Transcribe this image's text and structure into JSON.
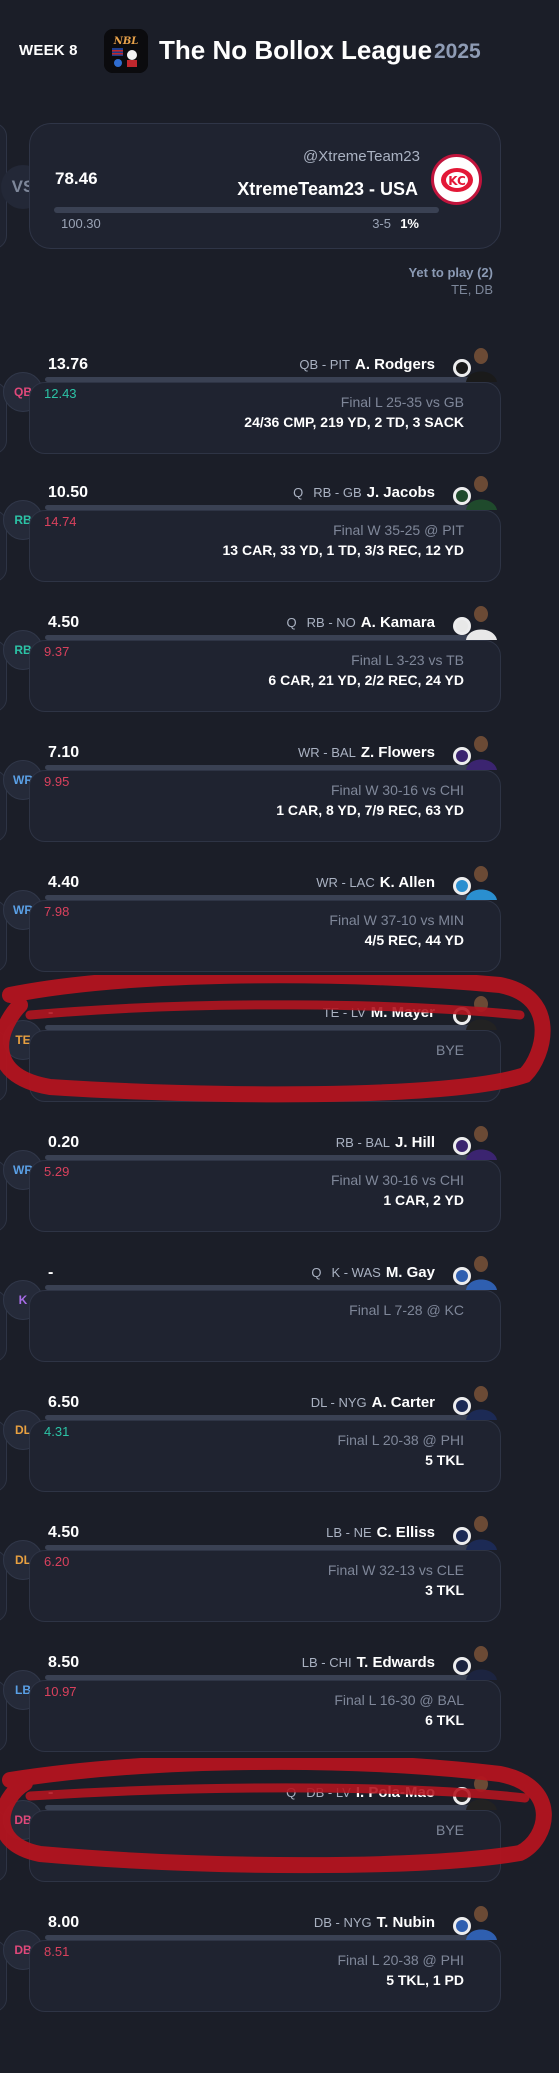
{
  "header": {
    "week": "WEEK 8",
    "league_name": "The No Bollox League",
    "year": "2025",
    "logo_icon": "nbl-logo-icon"
  },
  "matchup": {
    "vs_label": "VS",
    "score": "78.46",
    "projected": "100.30",
    "handle": "@XtremeTeam23",
    "team_name": "XtremeTeam23 - USA",
    "record": "3-5",
    "win_pct": "1%",
    "team_logo_icon": "chiefs-logo-icon"
  },
  "yet_to_play": {
    "title": "Yet to play (2)",
    "positions": "TE, DB"
  },
  "players": [
    {
      "slot": "QB",
      "slot_color": "#e0487a",
      "score": "13.76",
      "proj": "12.43",
      "proj_trend": "good",
      "status": "",
      "meta": "QB - PIT",
      "name": "A. Rodgers",
      "game": "Final L 25-35 vs GB",
      "stats": "24/36 CMP, 219 YD, 2 TD, 3 SACK",
      "jersey": "#1a1a1a"
    },
    {
      "slot": "RB",
      "slot_color": "#2cc3a6",
      "score": "10.50",
      "proj": "14.74",
      "proj_trend": "bad",
      "status": "Q",
      "meta": "RB - GB",
      "name": "J. Jacobs",
      "game": "Final W 35-25 @ PIT",
      "stats": "13 CAR, 33 YD, 1 TD, 3/3 REC, 12 YD",
      "jersey": "#1f4a2c"
    },
    {
      "slot": "RB",
      "slot_color": "#2cc3a6",
      "score": "4.50",
      "proj": "9.37",
      "proj_trend": "bad",
      "status": "Q",
      "meta": "RB - NO",
      "name": "A. Kamara",
      "game": "Final L 3-23 vs TB",
      "stats": "6 CAR, 21 YD, 2/2 REC, 24 YD",
      "jersey": "#e8e8e8"
    },
    {
      "slot": "WR",
      "slot_color": "#5aa0e6",
      "score": "7.10",
      "proj": "9.95",
      "proj_trend": "bad",
      "status": "",
      "meta": "WR - BAL",
      "name": "Z. Flowers",
      "game": "Final W 30-16 vs CHI",
      "stats": "1 CAR, 8 YD, 7/9 REC, 63 YD",
      "jersey": "#3b2470"
    },
    {
      "slot": "WR",
      "slot_color": "#5aa0e6",
      "score": "4.40",
      "proj": "7.98",
      "proj_trend": "bad",
      "status": "",
      "meta": "WR - LAC",
      "name": "K. Allen",
      "game": "Final W 37-10 vs MIN",
      "stats": "4/5 REC, 44 YD",
      "jersey": "#2a8fd0"
    },
    {
      "slot": "TE",
      "slot_color": "#e8a040",
      "score": "-",
      "proj": "",
      "proj_trend": "",
      "status": "",
      "meta": "TE - LV",
      "name": "M. Mayer",
      "game": "BYE",
      "stats": "",
      "jersey": "#222222"
    },
    {
      "slot": "WR",
      "slot_color": "#5aa0e6",
      "score": "0.20",
      "proj": "5.29",
      "proj_trend": "bad",
      "status": "",
      "meta": "RB - BAL",
      "name": "J. Hill",
      "game": "Final W 30-16 vs CHI",
      "stats": "1 CAR, 2 YD",
      "jersey": "#3b2470"
    },
    {
      "slot": "K",
      "slot_color": "#a66ce6",
      "score": "-",
      "proj": "",
      "proj_trend": "",
      "status": "Q",
      "meta": "K - WAS",
      "name": "M. Gay",
      "game": "Final L 7-28 @ KC",
      "stats": "",
      "jersey": "#2f5fb0"
    },
    {
      "slot": "DL",
      "slot_color": "#e8a040",
      "score": "6.50",
      "proj": "4.31",
      "proj_trend": "good",
      "status": "",
      "meta": "DL - NYG",
      "name": "A. Carter",
      "game": "Final L 20-38 @ PHI",
      "stats": "5 TKL",
      "jersey": "#1c2a55"
    },
    {
      "slot": "DL",
      "slot_color": "#e8a040",
      "score": "4.50",
      "proj": "6.20",
      "proj_trend": "bad",
      "status": "",
      "meta": "LB - NE",
      "name": "C. Elliss",
      "game": "Final W 32-13 vs CLE",
      "stats": "3 TKL",
      "jersey": "#1c2a55"
    },
    {
      "slot": "LB",
      "slot_color": "#5aa0e6",
      "score": "8.50",
      "proj": "10.97",
      "proj_trend": "bad",
      "status": "",
      "meta": "LB - CHI",
      "name": "T. Edwards",
      "game": "Final L 16-30 @ BAL",
      "stats": "6 TKL",
      "jersey": "#1c2440"
    },
    {
      "slot": "DB",
      "slot_color": "#e0487a",
      "score": "-",
      "proj": "",
      "proj_trend": "",
      "status": "Q",
      "meta": "DB - LV",
      "name": "I. Pola-Mao",
      "game": "BYE",
      "stats": "",
      "jersey": "#222222"
    },
    {
      "slot": "DB",
      "slot_color": "#e0487a",
      "score": "8.00",
      "proj": "8.51",
      "proj_trend": "bad",
      "status": "",
      "meta": "DB - NYG",
      "name": "T. Nubin",
      "game": "Final L 20-38 @ PHI",
      "stats": "5 TKL, 1 PD",
      "jersey": "#2f5fb0"
    }
  ]
}
